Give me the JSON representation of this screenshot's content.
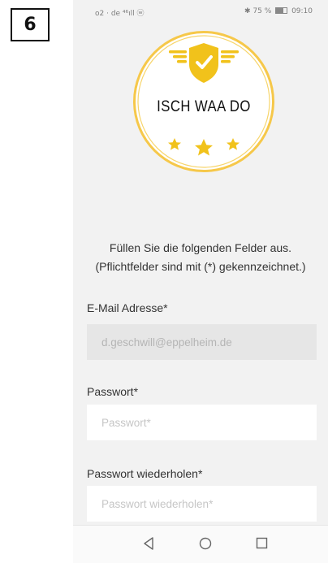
{
  "step_number": "6",
  "status_bar": {
    "left": "o2 · de ⁴⁶ıll ⓦ",
    "right_bt": "✱",
    "right_batt": "75 %",
    "right_time": "09:10"
  },
  "logo": {
    "text": "ISCH WAA DO",
    "colors": {
      "gold": "#f1c21b",
      "ring": "#f5c842",
      "check": "#ffffff"
    }
  },
  "instructions": {
    "line1": "Füllen Sie die folgenden Felder aus.",
    "line2": "(Pflichtfelder sind mit (*) gekennzeichnet.)"
  },
  "form": {
    "email_label": "E-Mail Adresse*",
    "email_value": "d.geschwill@eppelheim.de",
    "password_label": "Passwort*",
    "password_placeholder": "Passwort*",
    "password_repeat_label": "Passwort wiederholen*",
    "password_repeat_placeholder": "Passwort wiederholen*"
  },
  "nav_bar": {
    "icons": [
      "back-icon",
      "home-icon",
      "recents-icon"
    ]
  }
}
